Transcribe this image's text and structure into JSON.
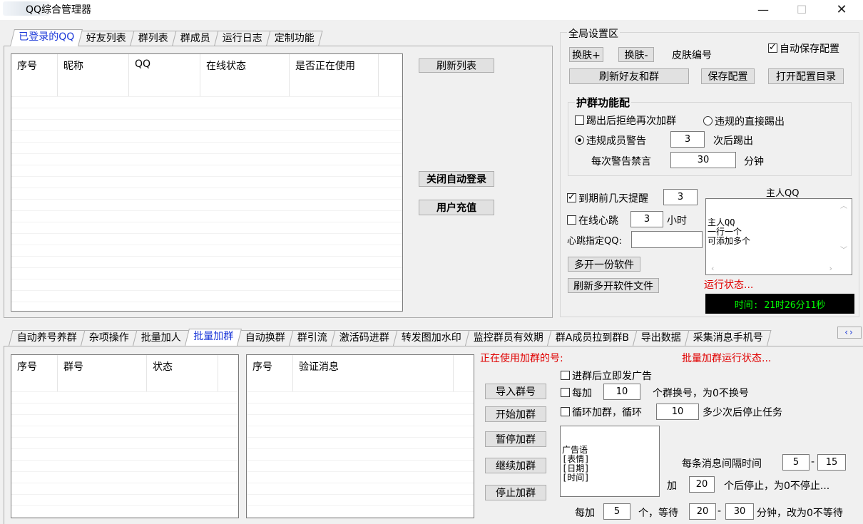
{
  "window": {
    "title": "QQ综合管理器",
    "minimize_glyph": "—",
    "maximize_glyph": "☐",
    "close_glyph": "✕"
  },
  "top_tabs": [
    "已登录的QQ",
    "好友列表",
    "群列表",
    "群成员",
    "运行日志",
    "定制功能"
  ],
  "logged_list": {
    "columns": [
      "序号",
      "昵称",
      "QQ",
      "在线状态",
      "是否正在使用"
    ]
  },
  "logged_buttons": {
    "refresh": "刷新列表",
    "close_auto_login": "关闭自动登录",
    "user_recharge": "用户充值"
  },
  "global": {
    "group_title": "全局设置区",
    "skin_plus": "换肤+",
    "skin_minus": "换肤-",
    "skin_label": "皮肤编号",
    "auto_save_label": "自动保存配置",
    "refresh_friends_groups": "刷新好友和群",
    "save_config": "保存配置",
    "open_config_dir": "打开配置目录",
    "protect_title": "护群功能配",
    "kick_refuse_label": "踢出后拒绝再次加群",
    "kick_direct_label": "违规的直接踢出",
    "warn_label": "违规成员警告",
    "warn_times": "3",
    "kick_after_label": "次后踢出",
    "mute_label": "每次警告禁言",
    "mute_minutes": "30",
    "minutes_label": "分钟",
    "expire_remind_label": "到期前几天提醒",
    "expire_days": "3",
    "heartbeat_label": "在线心跳",
    "heartbeat_hours": "3",
    "hours_label": "小时",
    "heartbeat_qq_label": "心跳指定QQ:",
    "heartbeat_qq": "",
    "owner_qq_title": "主人QQ",
    "owner_qq_text": "主人QQ\n一行一个\n可添加多个",
    "multi_open": "多开一份软件",
    "refresh_multi": "刷新多开软件文件",
    "run_status": "运行状态...",
    "time_display": "时间: 21时26分11秒"
  },
  "bottom_tabs": [
    "自动养号养群",
    "杂项操作",
    "批量加人",
    "批量加群",
    "自动换群",
    "群引流",
    "激活码进群",
    "转发图加水印",
    "监控群员有效期",
    "群A成员拉到群B",
    "导出数据",
    "采集消息手机号"
  ],
  "bottom_tab_scroll": "‹›",
  "group_list": {
    "columns": [
      "序号",
      "群号",
      "状态"
    ]
  },
  "verify_list": {
    "columns": [
      "序号",
      "验证消息"
    ]
  },
  "batch_join": {
    "using_label": "正在使用加群的号:",
    "status_label": "批量加群运行状态...",
    "import_btn": "导入群号",
    "start_btn": "开始加群",
    "pause_btn": "暂停加群",
    "continue_btn": "继续加群",
    "stop_btn": "停止加群",
    "ad_after_join_label": "进群后立即发广告",
    "every_add_label": "每加",
    "every_add_value": "10",
    "switch_label": "个群换号，为0不换号",
    "loop_label": "循环加群，循环",
    "loop_value": "10",
    "loop_stop_label": "多少次后停止任务",
    "ad_text": "广告语\n[表情]\n[日期]\n[时间]",
    "interval_label": "每条消息间隔时间",
    "interval_min": "5",
    "interval_max": "15",
    "dash": "-",
    "add_label": "加",
    "add_stop_value": "20",
    "add_stop_label": "个后停止，为0不停止...",
    "wait_label_a": "每加",
    "wait_every": "5",
    "wait_label_b": "个，等待",
    "wait_min": "20",
    "wait_max": "30",
    "wait_label_c": "分钟，改为0不等待"
  }
}
